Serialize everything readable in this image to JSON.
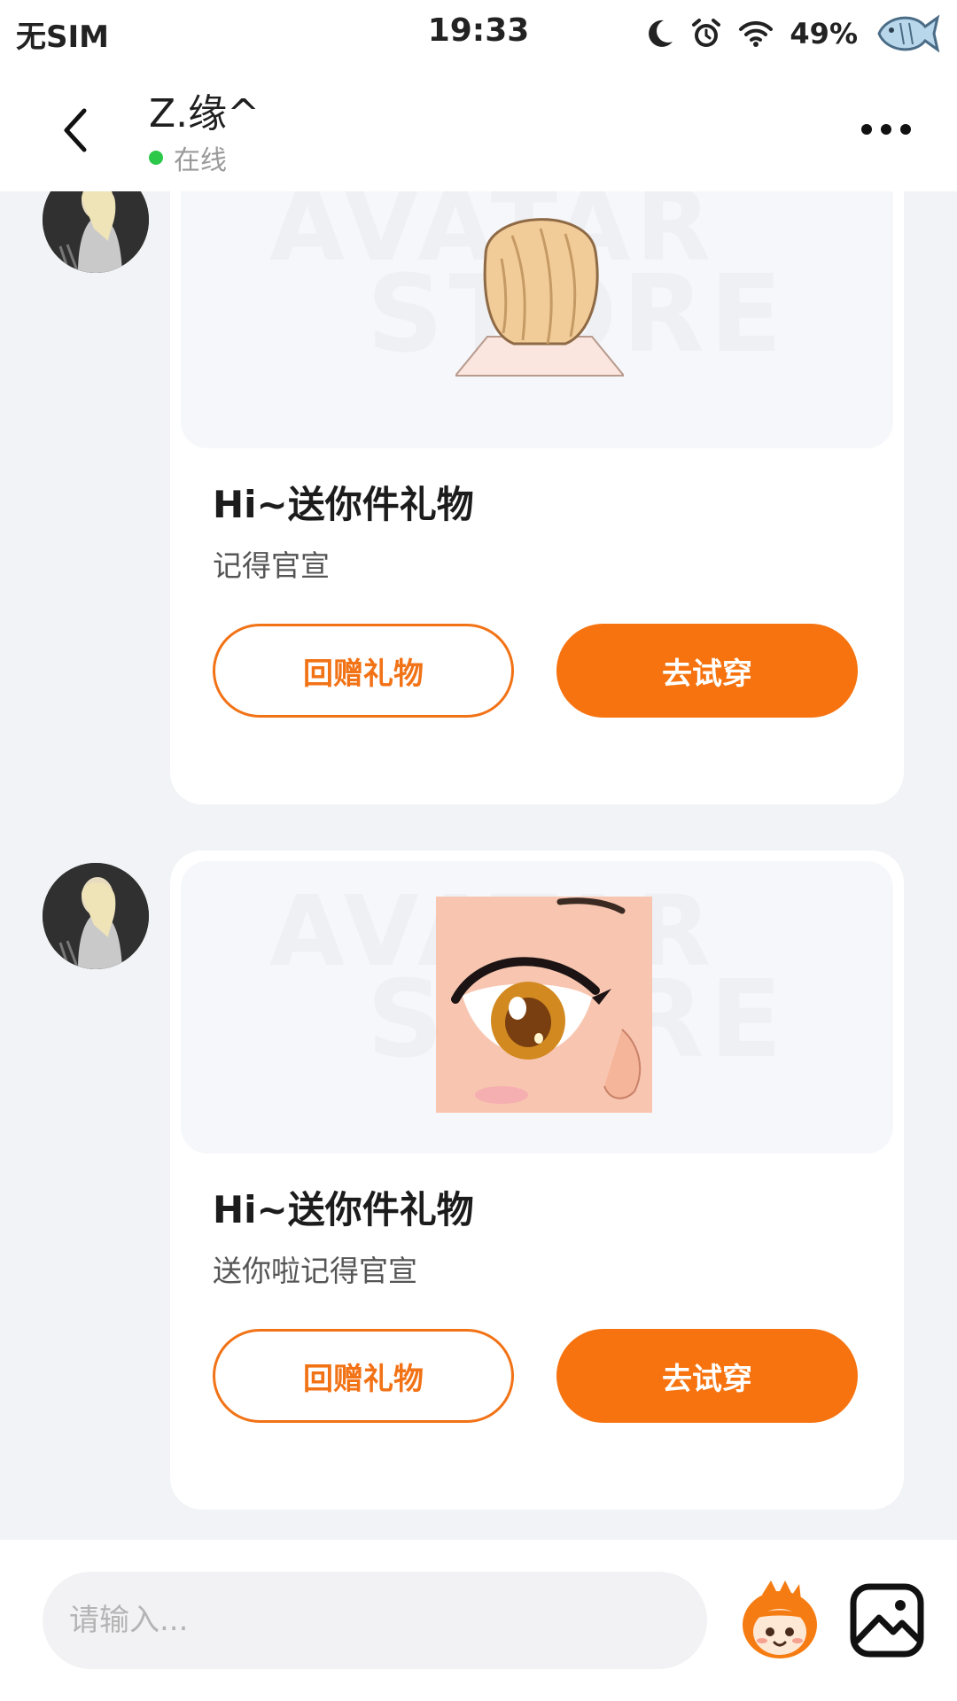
{
  "status_bar": {
    "carrier": "无SIM",
    "time": "19:33",
    "battery": "49%",
    "icons": [
      "moon-icon",
      "alarm-icon",
      "wifi-icon",
      "fish-icon"
    ]
  },
  "header": {
    "contact_name": "Z.缘^",
    "presence": "在线",
    "presence_color": "#2bc84a",
    "back_icon": "chevron-left-icon",
    "more_icon": "more-dots-icon"
  },
  "messages": [
    {
      "type": "gift",
      "preview": "blonde-hair-item",
      "watermark": [
        "AVATAR",
        "STORE"
      ],
      "title": "Hi~送你件礼物",
      "text": "记得官宣",
      "return_gift_label": "回赠礼物",
      "try_on_label": "去试穿"
    },
    {
      "type": "gift",
      "preview": "anime-eye-item",
      "watermark": [
        "AVATAR",
        "STORE"
      ],
      "title": "Hi~送你件礼物",
      "text": "送你啦记得官宣",
      "return_gift_label": "回赠礼物",
      "try_on_label": "去试穿"
    }
  ],
  "input_bar": {
    "placeholder": "请输入...",
    "emoji_icon": "mascot-emoji-icon",
    "image_icon": "image-icon"
  },
  "colors": {
    "accent": "#f6730f",
    "page_background": "#f1f3f6",
    "card_background": "#ffffff"
  }
}
